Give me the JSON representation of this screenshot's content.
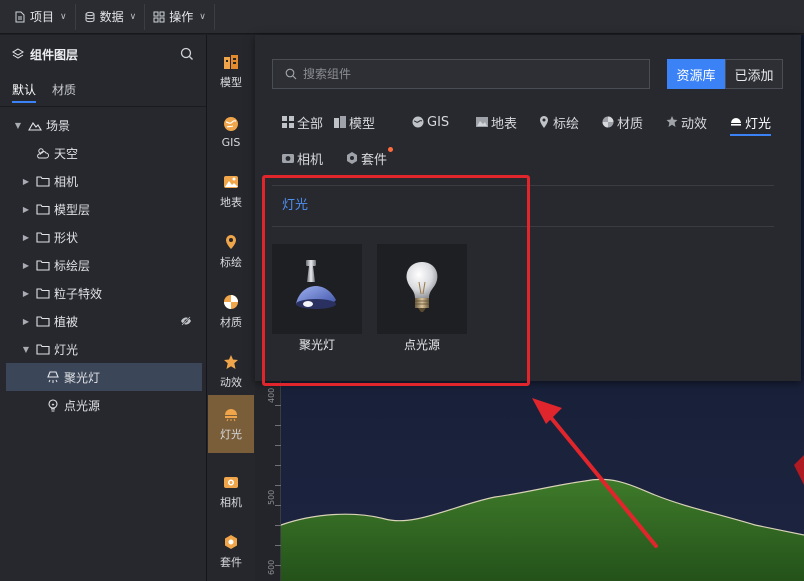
{
  "topbar": {
    "menus": [
      {
        "label": "项目",
        "icon": "file-icon"
      },
      {
        "label": "数据",
        "icon": "database-icon"
      },
      {
        "label": "操作",
        "icon": "grid-icon"
      }
    ]
  },
  "left_panel": {
    "title": "组件图层",
    "tabs": [
      "默认",
      "材质"
    ],
    "active_tab": "默认",
    "tree": [
      {
        "label": "场景",
        "icon": "scene-icon",
        "expanded": true,
        "level": 0
      },
      {
        "label": "天空",
        "icon": "sky-icon",
        "level": 1
      },
      {
        "label": "相机",
        "icon": "folder-icon",
        "level": 1
      },
      {
        "label": "模型层",
        "icon": "folder-icon",
        "level": 1
      },
      {
        "label": "形状",
        "icon": "folder-icon",
        "level": 1
      },
      {
        "label": "标绘层",
        "icon": "folder-icon",
        "level": 1
      },
      {
        "label": "粒子特效",
        "icon": "folder-icon",
        "level": 1
      },
      {
        "label": "植被",
        "icon": "folder-icon",
        "level": 1,
        "hidden": true
      },
      {
        "label": "灯光",
        "icon": "folder-icon",
        "level": 1,
        "expanded": true
      },
      {
        "label": "聚光灯",
        "icon": "spotlight-icon",
        "level": 2,
        "selected": true
      },
      {
        "label": "点光源",
        "icon": "bulb-icon",
        "level": 2
      }
    ]
  },
  "icon_strip": {
    "items": [
      {
        "label": "模型",
        "icon": "model-icon"
      },
      {
        "label": "GIS",
        "icon": "gis-icon"
      },
      {
        "label": "地表",
        "icon": "terrain-icon"
      },
      {
        "label": "标绘",
        "icon": "marker-icon"
      },
      {
        "label": "材质",
        "icon": "material-icon"
      },
      {
        "label": "动效",
        "icon": "effect-icon"
      },
      {
        "label": "灯光",
        "icon": "light-icon"
      },
      {
        "label": "相机",
        "icon": "camera-icon"
      },
      {
        "label": "套件",
        "icon": "kit-icon"
      }
    ],
    "active": "灯光"
  },
  "resource_panel": {
    "search_placeholder": "搜索组件",
    "btn_library": "资源库",
    "btn_added": "已添加",
    "categories": [
      {
        "label": "全部",
        "icon": "all-icon"
      },
      {
        "label": "模型",
        "icon": "model-icon"
      },
      {
        "label": "GIS",
        "icon": "gis-icon"
      },
      {
        "label": "地表",
        "icon": "terrain-icon"
      },
      {
        "label": "标绘",
        "icon": "marker-icon"
      },
      {
        "label": "材质",
        "icon": "material-icon"
      },
      {
        "label": "动效",
        "icon": "effect-icon"
      },
      {
        "label": "灯光",
        "icon": "light-icon"
      },
      {
        "label": "相机",
        "icon": "camera-icon"
      },
      {
        "label": "套件",
        "icon": "kit-icon"
      }
    ],
    "active_category": "灯光",
    "section_title": "灯光",
    "items": [
      {
        "label": "聚光灯",
        "icon": "spotlight-icon"
      },
      {
        "label": "点光源",
        "icon": "bulb-icon"
      }
    ]
  },
  "ruler": {
    "labels": [
      "400",
      "500",
      "600"
    ]
  },
  "colors": {
    "accent": "#3b82f6",
    "annotation": "#e0262c",
    "active_strip": "#7a5e3a"
  }
}
